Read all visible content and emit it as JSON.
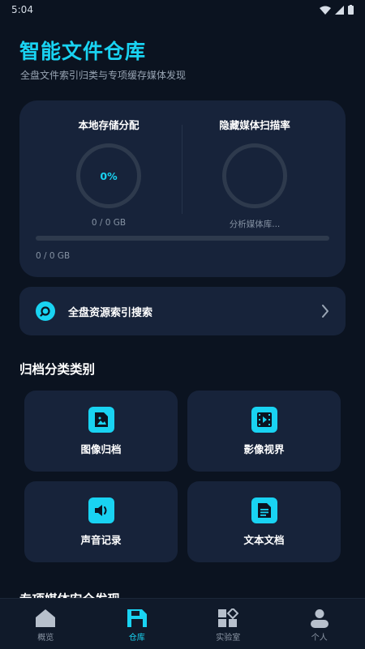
{
  "status_bar": {
    "time": "5:04"
  },
  "header": {
    "title": "智能文件仓库",
    "subtitle": "全盘文件索引归类与专项缓存媒体发现"
  },
  "storage_card": {
    "local": {
      "title": "本地存储分配",
      "percent_label": "0%",
      "caption": "0 / 0 GB",
      "percent": 0
    },
    "hidden": {
      "title": "隐藏媒体扫描率",
      "caption": "分析媒体库..."
    },
    "progress": {
      "fraction": 0,
      "caption": "0 / 0 GB"
    }
  },
  "search": {
    "label": "全盘资源索引搜索"
  },
  "categories_section": {
    "title": "归档分类类别"
  },
  "categories": [
    {
      "label": "图像归档",
      "icon": "image-file-icon"
    },
    {
      "label": "影像视界",
      "icon": "video-film-icon"
    },
    {
      "label": "声音记录",
      "icon": "speaker-icon"
    },
    {
      "label": "文本文档",
      "icon": "document-icon"
    }
  ],
  "special_section": {
    "title": "专项媒体安全发现"
  },
  "bottom_nav": {
    "items": [
      {
        "label": "概览",
        "icon": "home-icon",
        "active": false
      },
      {
        "label": "仓库",
        "icon": "storage-icon",
        "active": true
      },
      {
        "label": "实验室",
        "icon": "lab-grid-icon",
        "active": false
      },
      {
        "label": "个人",
        "icon": "person-icon",
        "active": false
      }
    ]
  },
  "colors": {
    "accent": "#19d3f2",
    "background": "#0b1320",
    "card": "#17233a"
  }
}
